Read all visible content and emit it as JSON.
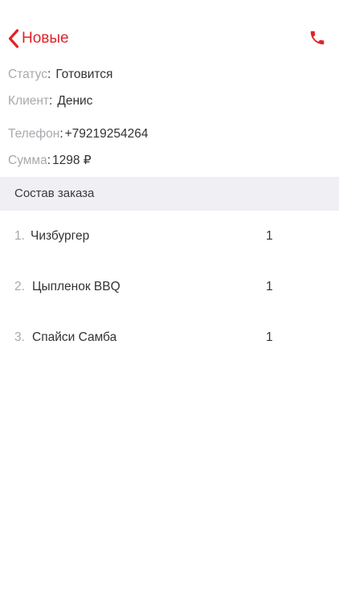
{
  "nav": {
    "back_label": "Новые",
    "back_icon": "chevron-left-icon",
    "call_icon": "phone-icon",
    "accent_color": "#e0242a"
  },
  "order": {
    "status": {
      "label": "Статус",
      "value": "Готовится"
    },
    "client": {
      "label": "Клиент",
      "value": "Денис"
    },
    "phone": {
      "label": "Телефон",
      "value": "+79219254264"
    },
    "total": {
      "label": "Сумма",
      "value": "1298 ₽"
    }
  },
  "section": {
    "title": "Состав заказа"
  },
  "items": [
    {
      "num": "1.",
      "name": "Чизбургер",
      "qty": "1"
    },
    {
      "num": "2.",
      "name": "Цыпленок BBQ",
      "qty": "1"
    },
    {
      "num": "3.",
      "name": "Спайси Самба",
      "qty": "1"
    }
  ]
}
